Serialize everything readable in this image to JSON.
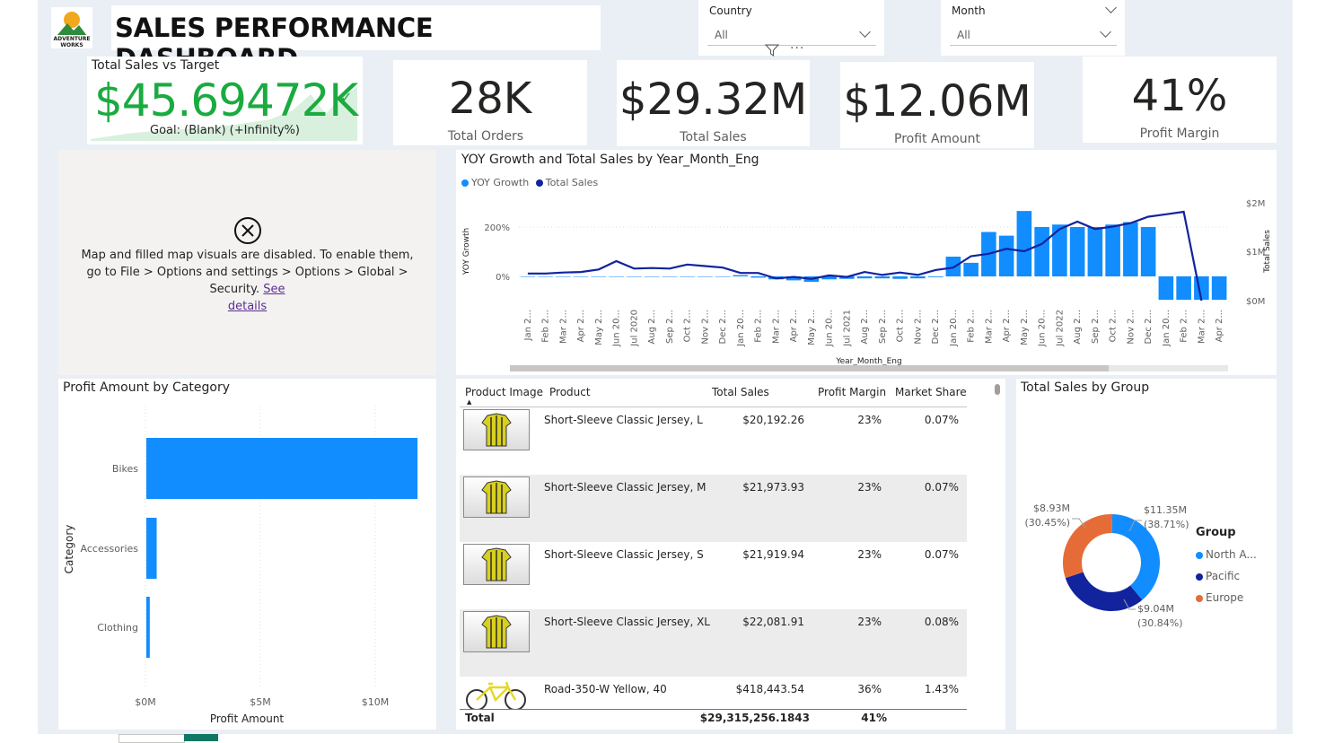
{
  "header": {
    "logo_text": "ADVENTURE WORKS",
    "title": "SALES PERFORMANCE DASHBOARD"
  },
  "slicers": {
    "country": {
      "label": "Country",
      "value": "All"
    },
    "month": {
      "label": "Month",
      "value": "All"
    }
  },
  "icons": {
    "filter": "filter-icon",
    "more": "more-options-icon",
    "close": "close-circle-icon"
  },
  "kpi_target": {
    "label": "Total Sales vs Target",
    "value": "$45.69472K",
    "goal": "Goal: (Blank) (+Infinity%)",
    "value_color": "#1aab40"
  },
  "kpis": [
    {
      "value": "28K",
      "label": "Total Orders"
    },
    {
      "value": "$29.32M",
      "label": "Total Sales"
    },
    {
      "value": "$12.06M",
      "label": "Profit Amount"
    },
    {
      "value": "41%",
      "label": "Profit Margin"
    }
  ],
  "map_notice": {
    "message": "Map and filled map visuals are disabled. To enable them, go to File > Options and settings > Options > Global > Security.",
    "link_see": "See",
    "link_details": "details"
  },
  "yoy_chart": {
    "title": "YOY Growth and Total Sales by Year_Month_Eng",
    "legend": [
      "YOY Growth",
      "Total Sales"
    ],
    "colors": {
      "bars": "#118dff",
      "line": "#12239e"
    }
  },
  "chart_data": [
    {
      "type": "bar+line",
      "title": "YOY Growth and Total Sales by Year_Month_Eng",
      "xlabel": "Year_Month_Eng",
      "ylabel": "YOY Growth",
      "y2label": "Total Sales",
      "y_ticks": [
        "0%",
        "200%"
      ],
      "y2_ticks": [
        "$0M",
        "$1M",
        "$2M"
      ],
      "x_tick_labels": [
        "Jan 2...",
        "Feb 2...",
        "Mar 2...",
        "Apr 2...",
        "May 2...",
        "Jun 20...",
        "Jul 2020",
        "Aug 2...",
        "Sep 2...",
        "Oct 2...",
        "Nov 2...",
        "Dec 2...",
        "Jan 20...",
        "Feb 2...",
        "Mar 2...",
        "Apr 2...",
        "May 2...",
        "Jun 20...",
        "Jul 2021",
        "Aug 2...",
        "Sep 2...",
        "Oct 2...",
        "Nov 2...",
        "Dec 2...",
        "Jan 20...",
        "Feb 2...",
        "Mar 2...",
        "Apr 2...",
        "May 2...",
        "Jun 20...",
        "Jul 2022",
        "Aug 2...",
        "Sep 2...",
        "Oct 2...",
        "Nov 2...",
        "Dec 2...",
        "Jan 20...",
        "Feb 2...",
        "Mar 2...",
        "Apr 2..."
      ],
      "yoy_growth_pct": [
        0,
        0,
        0,
        0,
        0,
        0,
        0,
        0,
        0,
        0,
        0,
        0,
        5,
        -5,
        -12,
        -16,
        -22,
        -12,
        -10,
        -8,
        -8,
        -10,
        -8,
        -3,
        80,
        55,
        180,
        165,
        265,
        200,
        210,
        200,
        200,
        210,
        220,
        200,
        -95,
        -95,
        -95,
        -95
      ],
      "total_sales_m": [
        0.55,
        0.55,
        0.57,
        0.58,
        0.63,
        0.8,
        0.65,
        0.66,
        0.65,
        0.73,
        0.7,
        0.67,
        0.56,
        0.56,
        0.45,
        0.48,
        0.44,
        0.51,
        0.48,
        0.58,
        0.52,
        0.57,
        0.52,
        0.62,
        0.67,
        0.9,
        0.95,
        1.05,
        1.0,
        1.15,
        1.45,
        1.6,
        1.45,
        1.5,
        1.57,
        1.7,
        1.75,
        1.8,
        0.0
      ]
    },
    {
      "type": "bar",
      "orientation": "horizontal",
      "title": "Profit Amount by Category",
      "categories": [
        "Bikes",
        "Accessories",
        "Clothing"
      ],
      "values": [
        11.8,
        0.45,
        0.15
      ],
      "unit": "$M",
      "xlabel": "Profit Amount",
      "ylabel": "Category",
      "x_ticks": [
        "$0M",
        "$5M",
        "$10M"
      ],
      "xlim": [
        0,
        12
      ]
    },
    {
      "type": "pie",
      "variant": "donut",
      "title": "Total Sales by Group",
      "legend_title": "Group",
      "categories": [
        "North A...",
        "Pacific",
        "Europe"
      ],
      "values": [
        11.35,
        9.04,
        8.93
      ],
      "labels": [
        "$11.35M (38.71%)",
        "$9.04M (30.84%)",
        "$8.93M (30.45%)"
      ],
      "colors": [
        "#118dff",
        "#12239e",
        "#e66c37"
      ]
    }
  ],
  "profit_by_category": {
    "title": "Profit Amount by Category",
    "xlabel": "Profit Amount",
    "ylabel": "Category",
    "color": "#118dff"
  },
  "product_table": {
    "columns": [
      "Product Image",
      "Product",
      "Total Sales",
      "Profit Margin",
      "Market Share"
    ],
    "rows": [
      {
        "product": "Short-Sleeve Classic Jersey, L",
        "sales": "$20,192.26",
        "margin": "23%",
        "share": "0.07%"
      },
      {
        "product": "Short-Sleeve Classic Jersey, M",
        "sales": "$21,973.93",
        "margin": "23%",
        "share": "0.07%"
      },
      {
        "product": "Short-Sleeve Classic Jersey, S",
        "sales": "$21,919.94",
        "margin": "23%",
        "share": "0.07%"
      },
      {
        "product": "Short-Sleeve Classic Jersey, XL",
        "sales": "$22,081.91",
        "margin": "23%",
        "share": "0.08%"
      },
      {
        "product": "Road-350-W Yellow, 40",
        "sales": "$418,443.54",
        "margin": "36%",
        "share": "1.43%"
      }
    ],
    "total": {
      "label": "Total",
      "sales": "$29,315,256.1843",
      "margin": "41%"
    }
  },
  "group_chart": {
    "title": "Total Sales by Group",
    "legend_title": "Group"
  }
}
